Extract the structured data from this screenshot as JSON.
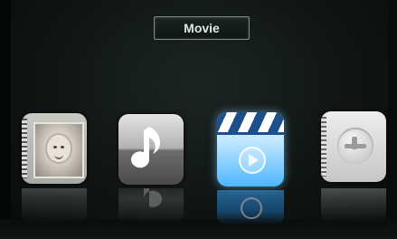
{
  "header": {
    "title": "Movie"
  },
  "menu": {
    "items": [
      {
        "id": "photo",
        "icon": "photo-frame-icon"
      },
      {
        "id": "music",
        "icon": "music-note-icon"
      },
      {
        "id": "movie",
        "icon": "clapperboard-play-icon",
        "selected": true
      },
      {
        "id": "settings",
        "icon": "notebook-settings-icon"
      }
    ]
  },
  "colors": {
    "selected_glow": "#4db6ff",
    "background": "#101514"
  }
}
